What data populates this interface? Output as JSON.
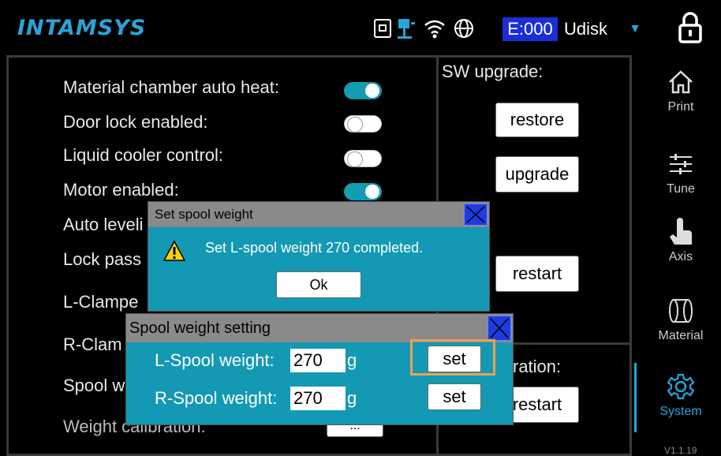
{
  "header": {
    "logo": "INTAMSYS",
    "status_code": "E:000",
    "storage_select": "Udisk",
    "icons": [
      "printer-usb-icon",
      "network-icon",
      "wifi-icon",
      "globe-icon",
      "lock-icon"
    ]
  },
  "settings": [
    {
      "label": "Material chamber auto heat:",
      "toggle": "on"
    },
    {
      "label": "Door lock enabled:",
      "toggle": "off"
    },
    {
      "label": "Liquid cooler control:",
      "toggle": "off"
    },
    {
      "label": "Motor enabled:",
      "toggle": "on"
    },
    {
      "label": "Auto leveli"
    },
    {
      "label": "Lock pass"
    },
    {
      "label": "L-Clampe"
    },
    {
      "label": "R-Clam"
    },
    {
      "label": "Spool w"
    },
    {
      "label": "Weight calibration:",
      "button": "..."
    }
  ],
  "right_panel": {
    "sw_upgrade_label": "SW upgrade:",
    "restore_button": "restore",
    "upgrade_button": "upgrade",
    "restart_button": "restart",
    "calibration_label": "ration:",
    "restart2_button": "restart"
  },
  "sidebar": {
    "items": [
      {
        "label": "Print",
        "icon": "home-icon"
      },
      {
        "label": "Tune",
        "icon": "sliders-icon"
      },
      {
        "label": "Axis",
        "icon": "hand-icon"
      },
      {
        "label": "Material",
        "icon": "spool-icon"
      },
      {
        "label": "System",
        "icon": "gear-icon",
        "active": true
      }
    ],
    "version": "V1.1.19"
  },
  "dialog_completed": {
    "title": "Set spool weight",
    "message": "Set L-spool weight 270 completed.",
    "ok_button": "Ok"
  },
  "dialog_spool": {
    "title": "Spool weight setting",
    "l_label": "L-Spool weight:",
    "l_value": "270",
    "l_unit": "g",
    "l_set": "set",
    "r_label": "R-Spool weight:",
    "r_value": "270",
    "r_unit": "g",
    "r_set": "set"
  },
  "colors": {
    "accent": "#2aa3d8",
    "dialog_bg": "#1399b3",
    "status_bg": "#1a2ed6",
    "highlight": "#f0a050"
  }
}
